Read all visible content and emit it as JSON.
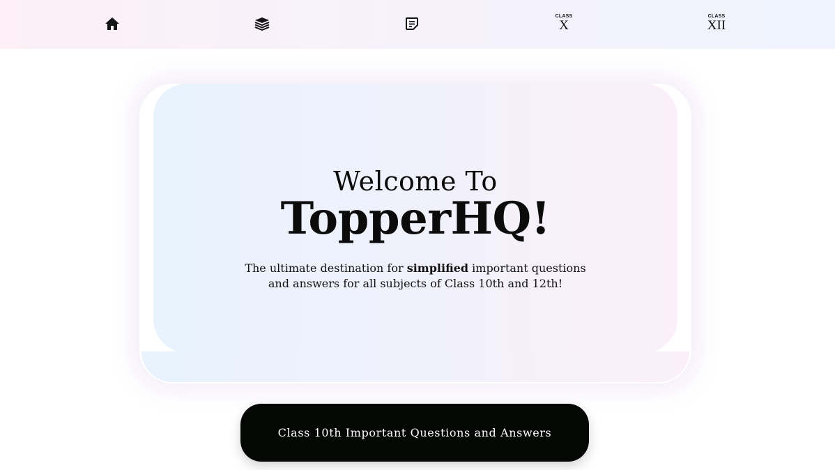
{
  "nav": {
    "items": [
      {
        "icon": "home-icon"
      },
      {
        "icon": "book-stack-icon"
      },
      {
        "icon": "note-icon"
      }
    ],
    "class_x": {
      "small": "CLASS",
      "numeral": "X"
    },
    "class_xii": {
      "small": "CLASS",
      "numeral": "XII"
    }
  },
  "hero": {
    "title_line1": "Welcome To",
    "title_line2": "TopperHQ!",
    "desc_before": "The ultimate destination for ",
    "desc_bold": "simplified",
    "desc_after": " important questions and answers for all subjects of Class 10th and 12th!"
  },
  "cta": {
    "label": "Class 10th Important Questions and Answers"
  },
  "colors": {
    "cta_bg": "#050705",
    "text": "#0b0b0b",
    "hero_gradient_left": "#e8f3fd",
    "hero_gradient_right": "#fbf0f9"
  }
}
